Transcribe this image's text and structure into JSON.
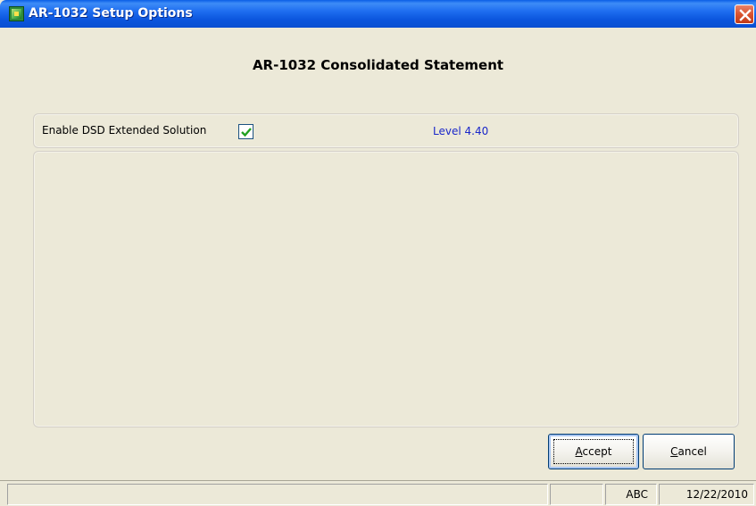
{
  "window": {
    "title": "AR-1032 Setup Options",
    "app_icon": "green-grid-app-icon",
    "close_icon": "close-icon"
  },
  "heading": "AR-1032 Consolidated Statement",
  "options": {
    "enable_label": "Enable DSD Extended Solution",
    "enable_checked": true,
    "level": "Level  4.40"
  },
  "buttons": {
    "accept_mnemonic": "A",
    "accept_rest": "ccept",
    "cancel_mnemonic": "C",
    "cancel_rest": "ancel"
  },
  "status": {
    "message": "",
    "middle": "",
    "company": "ABC",
    "date": "12/22/2010"
  },
  "colors": {
    "titlebar": "#0a5ee6",
    "level_text": "#1a27c9",
    "checkmark": "#21a121",
    "window_bg": "#ece9d8"
  }
}
